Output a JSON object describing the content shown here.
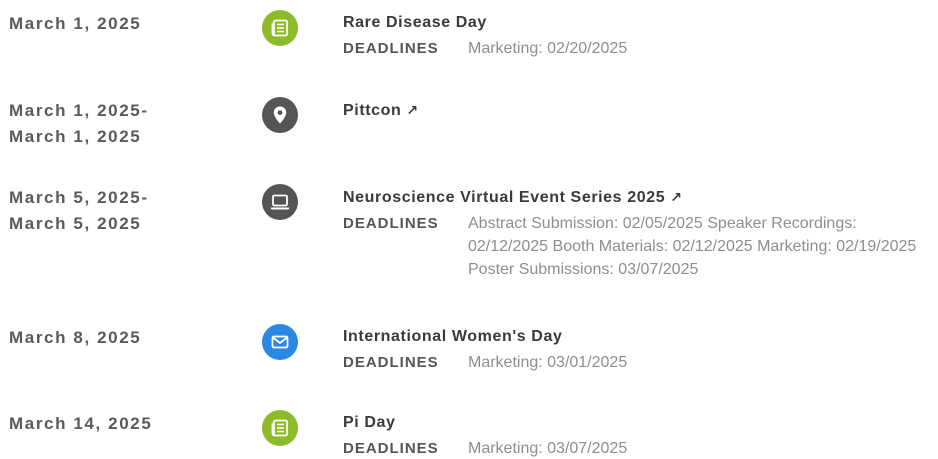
{
  "colors": {
    "green_icon": "#8cbb2c",
    "dark_icon": "#555555",
    "blue_icon": "#2c86e3"
  },
  "events": [
    {
      "date_line1": "March 1, 2025",
      "date_line2": "",
      "icon": "newspaper-icon",
      "title": "Rare Disease Day",
      "external": "",
      "deadlines_label": "DEADLINES",
      "deadlines": "Marketing: 02/20/2025"
    },
    {
      "date_line1": "March 1, 2025-",
      "date_line2": "March 1, 2025",
      "icon": "map-pin-icon",
      "title": "Pittcon",
      "external": "↗",
      "deadlines_label": "",
      "deadlines": ""
    },
    {
      "date_line1": "March 5, 2025-",
      "date_line2": "March 5, 2025",
      "icon": "laptop-icon",
      "title": "Neuroscience Virtual Event Series 2025",
      "external": "↗",
      "deadlines_label": "DEADLINES",
      "deadlines": "Abstract Submission: 02/05/2025 Speaker Recordings: 02/12/2025 Booth Materials: 02/12/2025 Marketing: 02/19/2025 Poster Submissions: 03/07/2025"
    },
    {
      "date_line1": "March 8, 2025",
      "date_line2": "",
      "icon": "envelope-icon",
      "title": "International Women's Day",
      "external": "",
      "deadlines_label": "DEADLINES",
      "deadlines": "Marketing: 03/01/2025"
    },
    {
      "date_line1": "March 14, 2025",
      "date_line2": "",
      "icon": "newspaper-icon",
      "title": "Pi Day",
      "external": "",
      "deadlines_label": "DEADLINES",
      "deadlines": "Marketing: 03/07/2025"
    }
  ]
}
